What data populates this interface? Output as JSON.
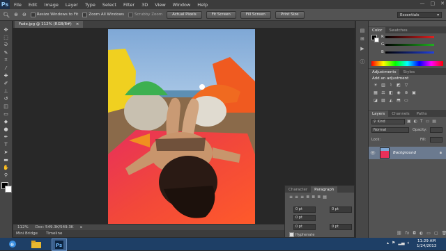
{
  "app": {
    "logo": "Ps"
  },
  "menu": [
    "File",
    "Edit",
    "Image",
    "Layer",
    "Type",
    "Select",
    "Filter",
    "3D",
    "View",
    "Window",
    "Help"
  ],
  "options_bar": {
    "checks": [
      "Resize Windows to Fit",
      "Zoom All Windows",
      "Scrubby Zoom"
    ],
    "buttons": [
      "Actual Pixels",
      "Fit Screen",
      "Fill Screen",
      "Print Size"
    ],
    "workspace": "Essentials"
  },
  "document": {
    "tab_title": "Fade.jpg @ 112% (RGB/8#)",
    "close": "×"
  },
  "status": {
    "zoom": "112%",
    "doc_size": "Doc: 549.3K/549.3K"
  },
  "bottom_tabs": [
    "Mini Bridge",
    "Timeline"
  ],
  "color_panel": {
    "tabs": [
      "Color",
      "Swatches"
    ],
    "channels": [
      "R",
      "G",
      "B"
    ],
    "slider_colors": [
      "#e02020",
      "#20b020",
      "#2040e0"
    ]
  },
  "adjustments_panel": {
    "tabs": [
      "Adjustments",
      "Styles"
    ],
    "heading": "Add an adjustment"
  },
  "layers_panel": {
    "tabs": [
      "Layers",
      "Channels",
      "Paths"
    ],
    "filter": "Kind",
    "blend_mode": "Normal",
    "opacity_label": "Opacity:",
    "fill_label": "Fill:",
    "lock_label": "Lock:",
    "layer_name": "Background"
  },
  "character_panel": {
    "tabs": [
      "Character",
      "Paragraph"
    ],
    "fields": [
      "0 pt",
      "0 pt",
      "0 pt",
      "0 pt",
      "0 pt"
    ],
    "hyphenate": "Hyphenate"
  },
  "taskbar": {
    "time": "11:29 AM",
    "date": "1/24/2013"
  },
  "colors": {
    "accent": "#1e3f66",
    "panel": "#535353",
    "workspace_bg": "#282828"
  }
}
